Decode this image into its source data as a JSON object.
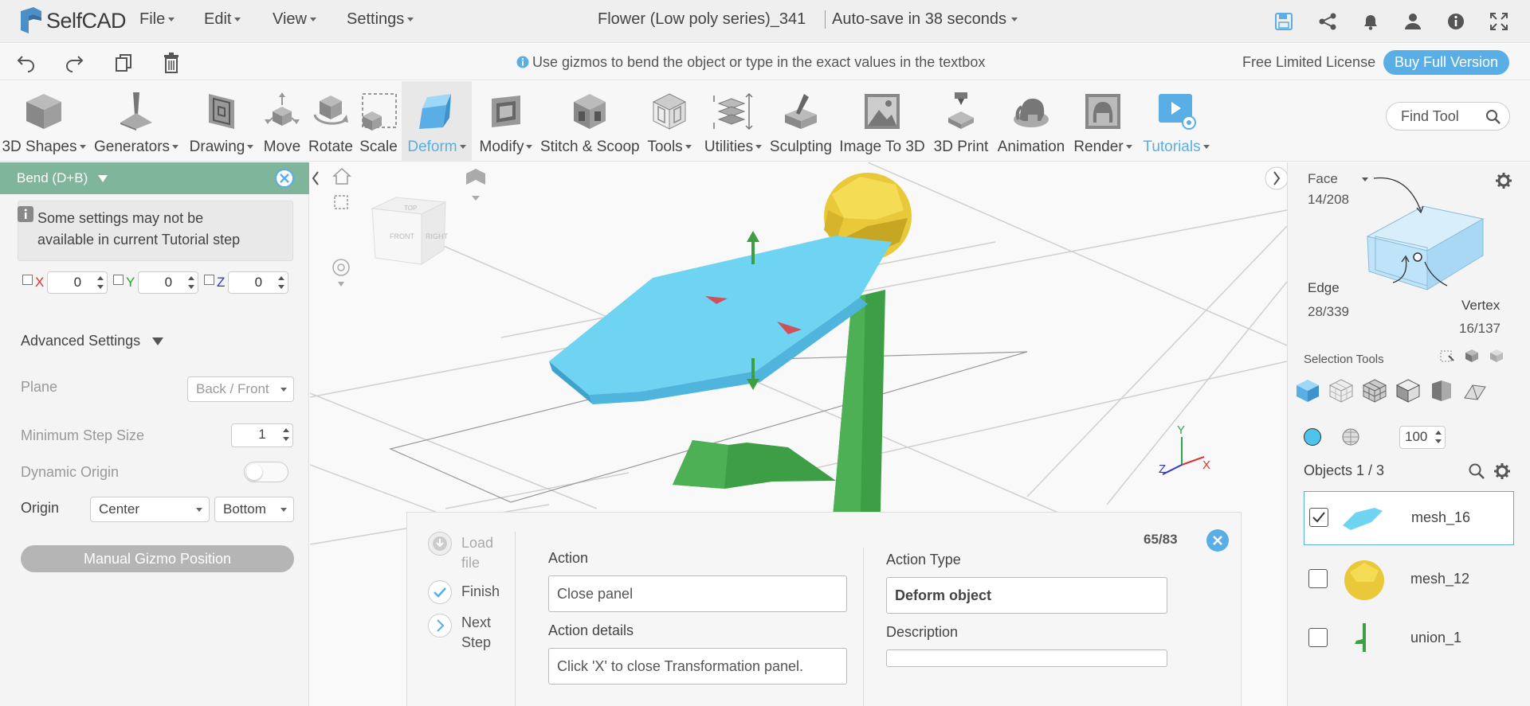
{
  "app": {
    "name": "SelfCAD"
  },
  "menu": [
    {
      "label": "File",
      "name": "file"
    },
    {
      "label": "Edit",
      "name": "edit"
    },
    {
      "label": "View",
      "name": "view"
    },
    {
      "label": "Settings",
      "name": "settings"
    }
  ],
  "document": {
    "title": "Flower (Low poly series)_341",
    "autosave": "Auto-save in 38 seconds"
  },
  "topicons": [
    "save-icon",
    "share-icon",
    "bell-icon",
    "user-icon",
    "info-icon",
    "fullscreen-icon"
  ],
  "bar2": {
    "hint": "Use gizmos to bend the object or type in the exact values in the textbox",
    "license": "Free Limited License",
    "buy": "Buy Full Version"
  },
  "tools": [
    {
      "label": "3D Shapes",
      "dd": true
    },
    {
      "label": "Generators",
      "dd": true
    },
    {
      "label": "Drawing",
      "dd": true
    },
    {
      "label": "Move",
      "dd": false
    },
    {
      "label": "Rotate",
      "dd": false
    },
    {
      "label": "Scale",
      "dd": false
    },
    {
      "label": "Deform",
      "dd": true,
      "active": true
    },
    {
      "label": "Modify",
      "dd": true
    },
    {
      "label": "Stitch & Scoop",
      "dd": false
    },
    {
      "label": "Tools",
      "dd": true
    },
    {
      "label": "Utilities",
      "dd": true
    },
    {
      "label": "Sculpting",
      "dd": false
    },
    {
      "label": "Image To 3D",
      "dd": false
    },
    {
      "label": "3D Print",
      "dd": false
    },
    {
      "label": "Animation",
      "dd": false
    },
    {
      "label": "Render",
      "dd": true
    },
    {
      "label": "Tutorials",
      "dd": true,
      "blue": true
    }
  ],
  "findtool": {
    "placeholder": "Find Tool"
  },
  "leftpanel": {
    "title": "Bend (D+B)",
    "note_line1": "Some settings may not be",
    "note_line2": "available in current Tutorial step",
    "axes": [
      {
        "label": "X",
        "value": "0",
        "color": "#d33"
      },
      {
        "label": "Y",
        "value": "0",
        "color": "#2a2"
      },
      {
        "label": "Z",
        "value": "0",
        "color": "#33c"
      }
    ],
    "advanced": "Advanced Settings",
    "plane_label": "Plane",
    "plane_value": "Back / Front",
    "min_step_label": "Minimum Step Size",
    "min_step_value": "1",
    "dynamic_origin_label": "Dynamic Origin",
    "origin_label": "Origin",
    "origin_value1": "Center",
    "origin_value2": "Bottom",
    "manual_button": "Manual Gizmo Position"
  },
  "viewcube": {
    "front": "FRONT",
    "right": "RIGHT",
    "top": "TOP"
  },
  "axes_gizmo": {
    "x": "X",
    "y": "Y",
    "z": "Z"
  },
  "tutorial": {
    "progress": "65/83",
    "steps": [
      {
        "line1": "Load",
        "line2": "file"
      },
      {
        "line1": "Finish",
        "line2": ""
      },
      {
        "line1": "Next",
        "line2": "Step"
      }
    ],
    "action_label": "Action",
    "action_value": "Close panel",
    "action_details_label": "Action details",
    "action_details_value": "Click 'X' to close Transformation panel.",
    "action_type_label": "Action Type",
    "action_type_value": "Deform object",
    "description_label": "Description",
    "description_value": ""
  },
  "rightpanel": {
    "face_label": "Face",
    "face_count": "14/208",
    "edge_label": "Edge",
    "edge_count": "28/339",
    "vertex_label": "Vertex",
    "vertex_count": "16/137",
    "selection_tools": "Selection Tools",
    "opacity": "100",
    "objects_label": "Objects 1 / 3",
    "objects": [
      {
        "name": "mesh_16",
        "checked": true
      },
      {
        "name": "mesh_12",
        "checked": false
      },
      {
        "name": "union_1",
        "checked": false
      }
    ]
  },
  "colors": {
    "accent": "#5aaee6",
    "panel_header": "#7fb59b",
    "petal": "#6fd3f2",
    "stem": "#3d9e45",
    "bud": "#e9c93a"
  }
}
